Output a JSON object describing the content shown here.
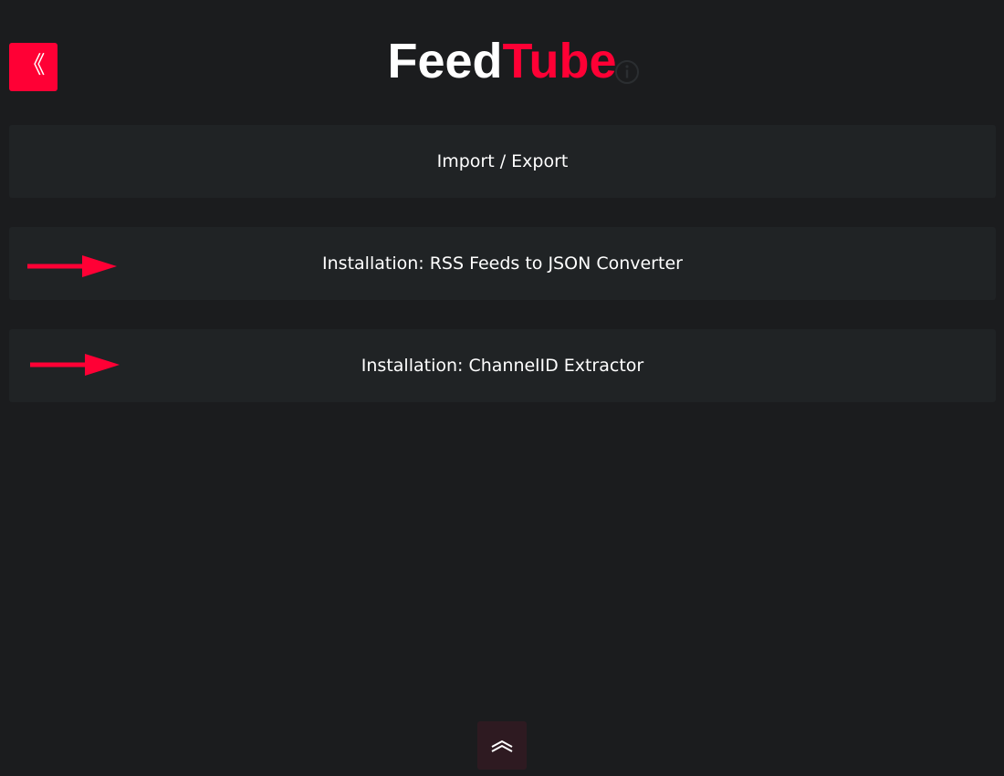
{
  "header": {
    "back_button": {
      "label": "《",
      "icon": "double-chevron-left-icon"
    },
    "logo": {
      "part1": "Feed",
      "part2": "Tube"
    },
    "info_icon": "info-icon"
  },
  "menu": {
    "items": [
      {
        "label": "Import / Export"
      },
      {
        "label": "Installation: RSS Feeds to JSON Converter"
      },
      {
        "label": "Installation: ChannelID Extractor"
      }
    ]
  },
  "annotations": {
    "arrows": [
      "arrow-right-icon",
      "arrow-right-icon"
    ]
  },
  "footer": {
    "scroll_top_icon": "double-chevron-up-icon"
  },
  "colors": {
    "accent": "#ff0035",
    "background": "#1b1c1e",
    "row_background": "#202325",
    "text": "#ffffff"
  }
}
